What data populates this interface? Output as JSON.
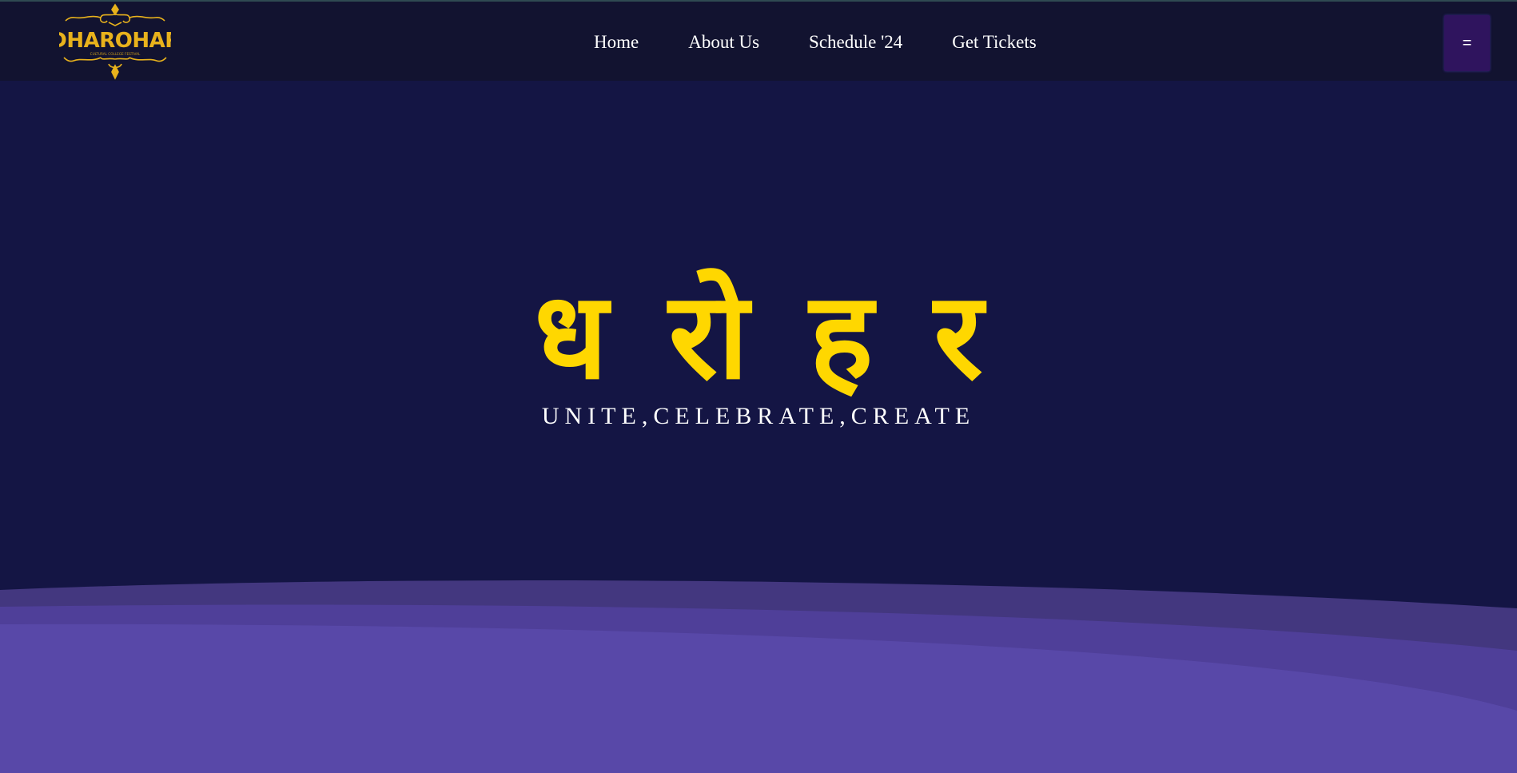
{
  "brand": {
    "logo_text": "DHAROHAR",
    "logo_subtext": "CULTURAL COLLEGE FESTIVAL",
    "logo_color": "#e8b21c"
  },
  "nav": {
    "items": [
      {
        "label": "Home"
      },
      {
        "label": "About Us"
      },
      {
        "label": "Schedule '24"
      },
      {
        "label": "Get Tickets"
      }
    ],
    "menu_button_label": "="
  },
  "hero": {
    "title_letters": [
      "ध",
      "रो",
      "ह",
      "र"
    ],
    "tagline": "UNITE,CELEBRATE,CREATE",
    "title_color": "#ffd700",
    "background": "#141544",
    "wave_colors": [
      "#43377f",
      "#4f3f99",
      "#5848a8"
    ]
  }
}
